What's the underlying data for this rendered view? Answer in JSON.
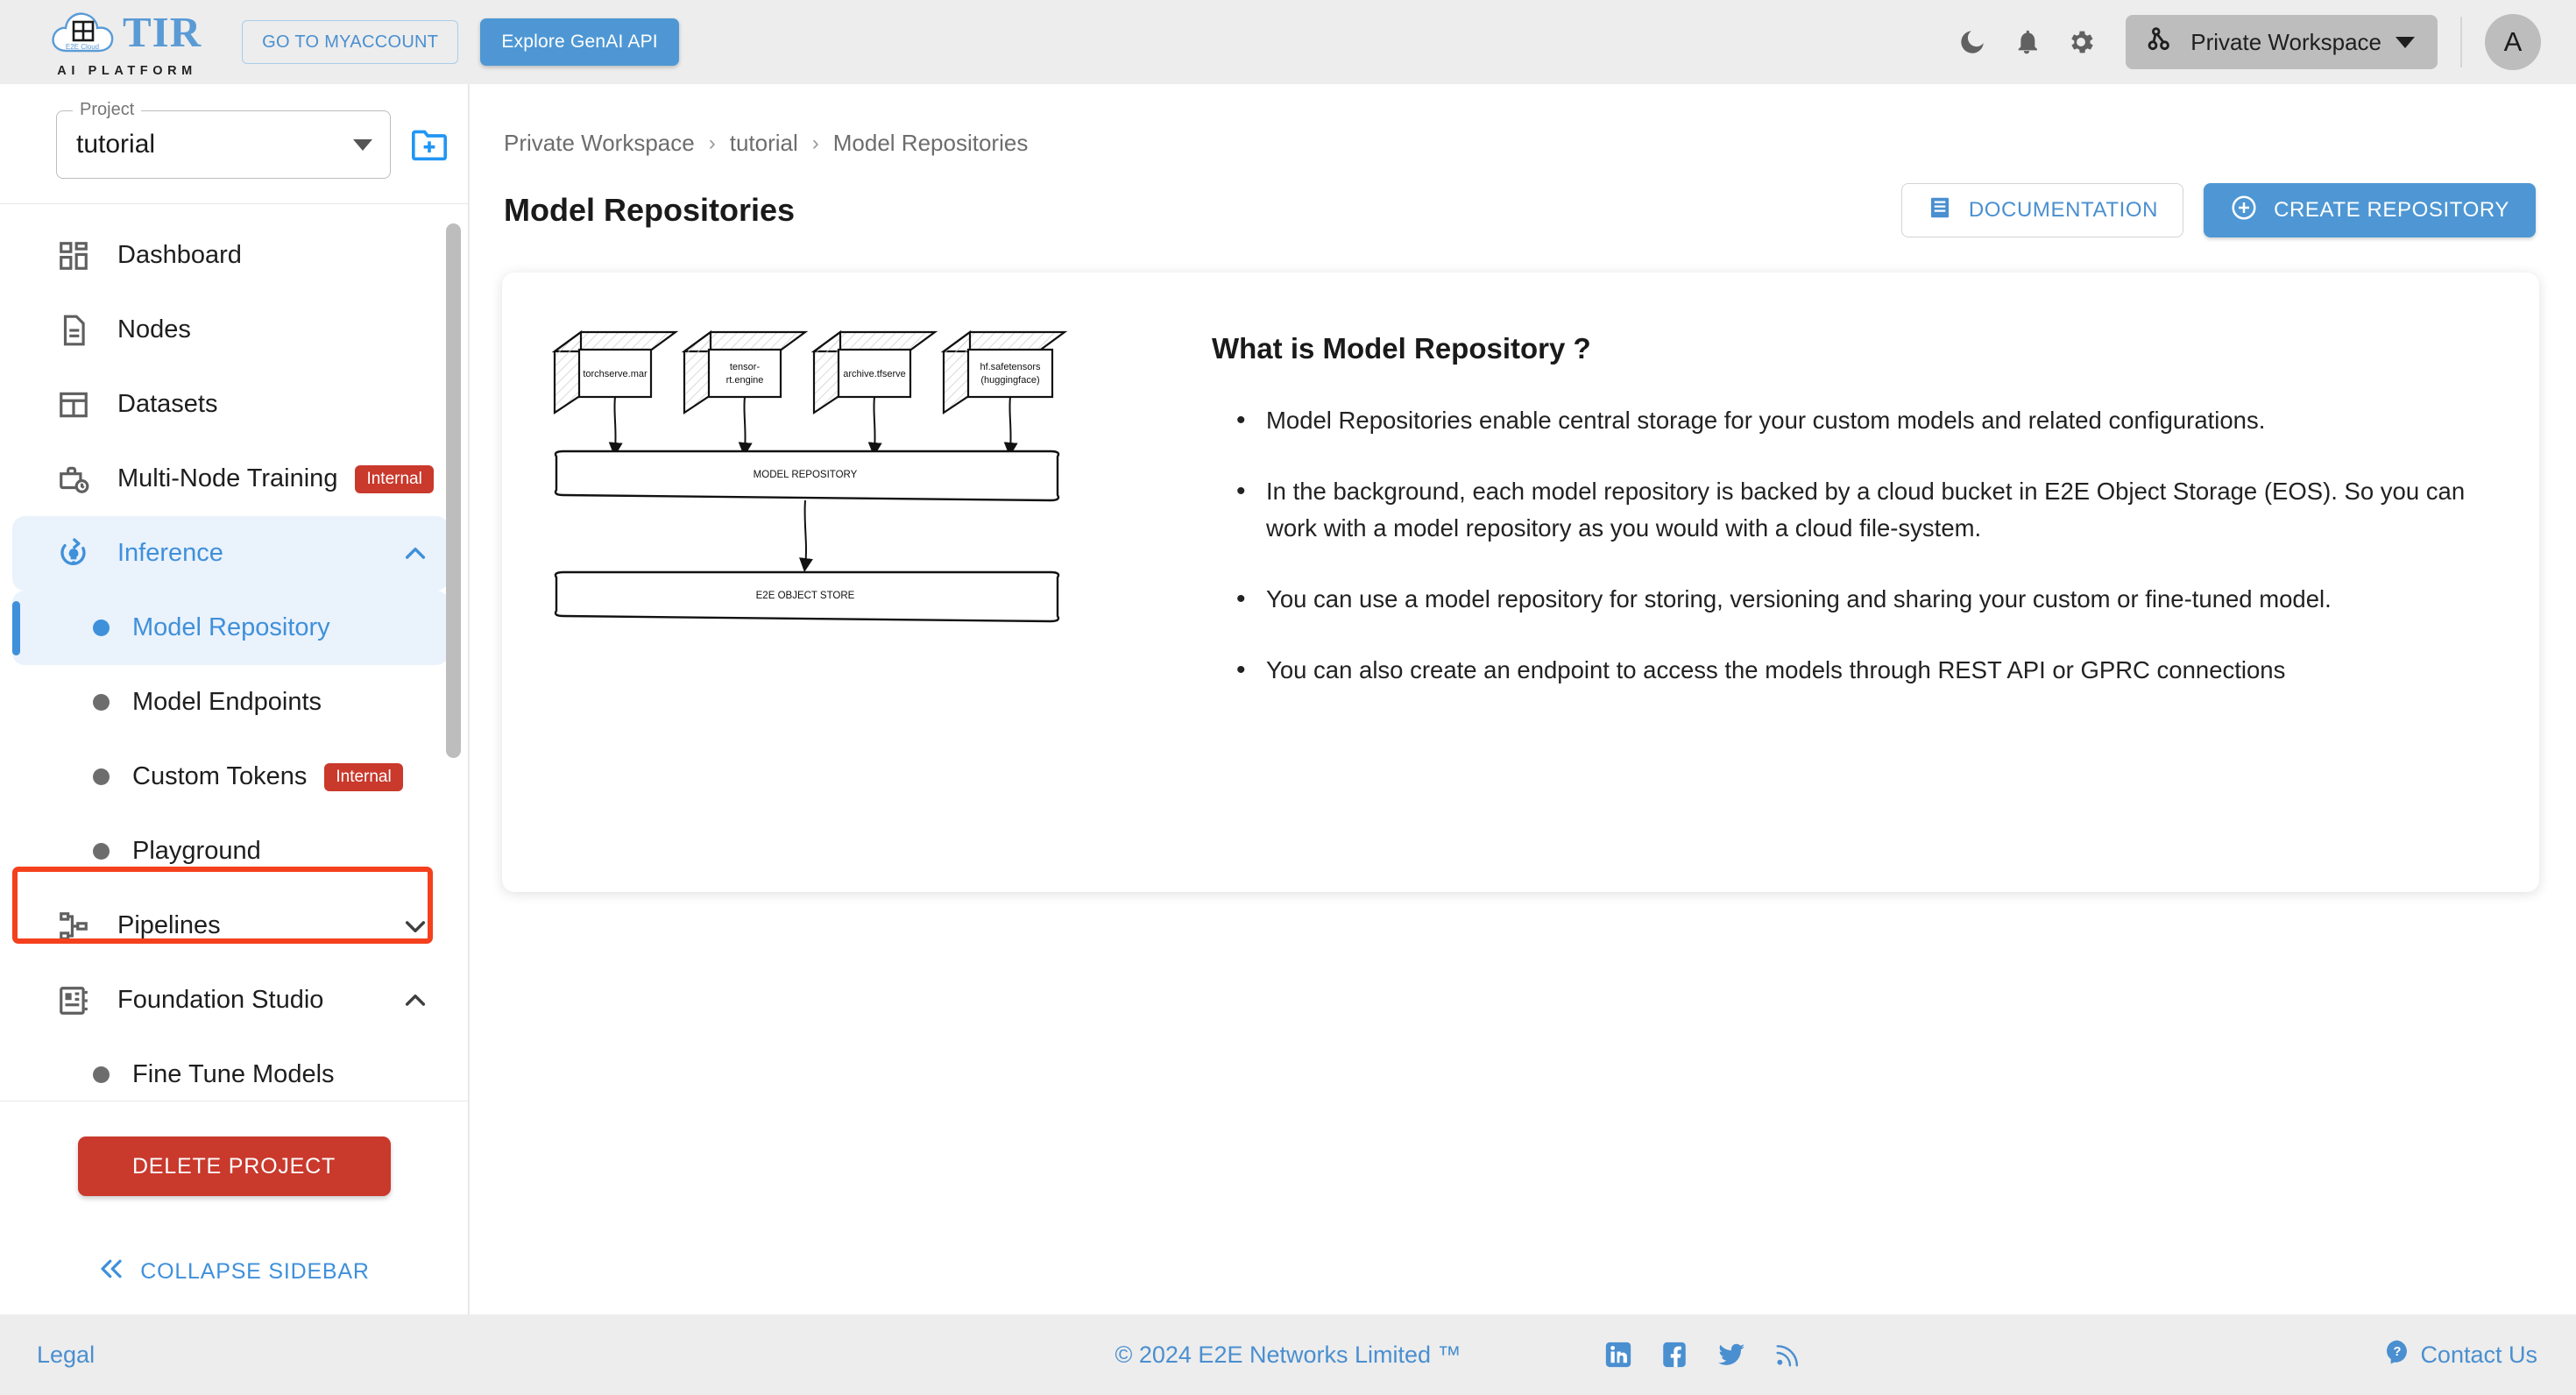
{
  "header": {
    "logo_text": "TIR",
    "logo_sub": "AI PLATFORM",
    "logo_cloud_text": "E2E Cloud",
    "myaccount_label": "GO TO MYACCOUNT",
    "genai_label": "Explore GenAI API",
    "workspace_label": "Private Workspace",
    "avatar_initial": "A",
    "icons": {
      "dark_mode": "moon-icon",
      "notifications": "bell-icon",
      "settings": "gear-icon",
      "workspace": "workspace-group-icon",
      "dropdown": "chevron-down-icon"
    }
  },
  "sidebar": {
    "project_label": "Project",
    "project_value": "tutorial",
    "add_project_icon": "add-folder-icon",
    "nav": [
      {
        "label": "Dashboard",
        "icon": "dashboard-icon",
        "type": "item",
        "active": false,
        "badge": null,
        "chevron": null
      },
      {
        "label": "Nodes",
        "icon": "document-icon",
        "type": "item",
        "active": false,
        "badge": null,
        "chevron": null
      },
      {
        "label": "Datasets",
        "icon": "table-icon",
        "type": "item",
        "active": false,
        "badge": null,
        "chevron": null
      },
      {
        "label": "Multi-Node Training",
        "icon": "briefcase-clock-icon",
        "type": "item",
        "active": false,
        "badge": "Internal",
        "chevron": null
      },
      {
        "label": "Inference",
        "icon": "inference-bulb-icon",
        "type": "item",
        "active": true,
        "badge": null,
        "chevron": "up"
      },
      {
        "label": "Model Repository",
        "icon": "dot",
        "type": "sub",
        "active": true,
        "badge": null,
        "chevron": null
      },
      {
        "label": "Model Endpoints",
        "icon": "dot",
        "type": "sub",
        "active": false,
        "badge": null,
        "chevron": null
      },
      {
        "label": "Custom Tokens",
        "icon": "dot",
        "type": "sub",
        "active": false,
        "badge": "Internal",
        "chevron": null
      },
      {
        "label": "Playground",
        "icon": "dot",
        "type": "sub",
        "active": false,
        "badge": null,
        "chevron": null
      },
      {
        "label": "Pipelines",
        "icon": "pipeline-icon",
        "type": "item",
        "active": false,
        "badge": null,
        "chevron": "down"
      },
      {
        "label": "Foundation Studio",
        "icon": "studio-icon",
        "type": "item",
        "active": false,
        "badge": null,
        "chevron": "up"
      },
      {
        "label": "Fine Tune Models",
        "icon": "dot",
        "type": "sub",
        "active": false,
        "badge": null,
        "chevron": null
      }
    ],
    "delete_project_label": "DELETE PROJECT",
    "collapse_label": "COLLAPSE SIDEBAR",
    "collapse_icon": "double-chevron-left-icon"
  },
  "main": {
    "breadcrumb": [
      "Private Workspace",
      "tutorial",
      "Model Repositories"
    ],
    "breadcrumb_separator": "›",
    "page_title": "Model Repositories",
    "documentation_label": "DOCUMENTATION",
    "documentation_icon": "article-icon",
    "create_label": "CREATE REPOSITORY",
    "create_icon": "plus-circle-icon",
    "info_card": {
      "heading": "What is Model Repository ?",
      "bullets": [
        "Model Repositories enable central storage for your custom models and related configurations.",
        "In the background, each model repository is backed by a cloud bucket in E2E Object Storage (EOS). So you can work with a model repository as you would with a cloud file-system.",
        "You can use a model repository for storing, versioning and sharing your custom or fine-tuned model.",
        "You can also create an endpoint to access the models through REST API or GPRC connections"
      ],
      "diagram": {
        "sources": [
          "torchserve.mar",
          "tensor-rt.engine",
          "archive.tfserve",
          "hf.safetensors (huggingface)"
        ],
        "middle": "MODEL REPOSITORY",
        "bottom": "E2E OBJECT STORE"
      }
    }
  },
  "footer": {
    "legal": "Legal",
    "copyright": "© 2024 E2E Networks Limited ™",
    "social": [
      "linkedin-icon",
      "facebook-icon",
      "twitter-icon",
      "rss-icon"
    ],
    "contact_label": "Contact Us",
    "contact_icon": "help-bubble-icon"
  },
  "colors": {
    "accent_blue": "#4e97d4",
    "danger_red": "#c9392c",
    "annotation_red": "#f4401d",
    "active_bg": "#eaf2fc"
  }
}
